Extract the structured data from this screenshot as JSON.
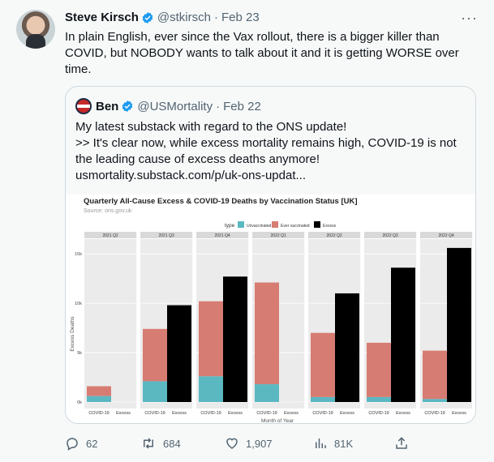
{
  "tweet": {
    "author_name": "Steve Kirsch",
    "handle": "@stkirsch",
    "separator": "·",
    "date": "Feb 23",
    "more": "···",
    "text": "In plain English, ever since the Vax rollout, there is a bigger killer than COVID, but NOBODY wants to talk about it and it is getting WORSE over time."
  },
  "quote": {
    "author_name": "Ben",
    "handle": "@USMortality",
    "separator": "·",
    "date": "Feb 22",
    "text_line1": "My latest substack with regard to the ONS update!",
    "text_line2": ">> It's clear now, while excess mortality remains high, COVID-19 is not the leading cause of excess deaths anymore!",
    "link": "usmortality.substack.com/p/uk-ons-updat..."
  },
  "actions": {
    "reply_count": "62",
    "retweet_count": "684",
    "like_count": "1,907",
    "views_count": "81K"
  },
  "colors": {
    "accent": "#1d9bf0",
    "unvaccinated": "#5bb8c1",
    "ever_vaccinated": "#d77c72",
    "excess": "#000000"
  },
  "chart_data": {
    "type": "bar",
    "title": "Quarterly All-Cause Excess & COVID-19 Deaths by Vaccination Status [UK]",
    "subtitle": "Source: ons.gov.uk",
    "legend_title": "type",
    "legend": [
      "Unvaccinated",
      "Ever vaccinated",
      "Excess"
    ],
    "legend_position": "top",
    "xlabel": "Month of Year",
    "ylabel": "Excess Deaths",
    "ylim": [
      0,
      16000
    ],
    "yticks": [
      "0k",
      "5k",
      "10k",
      "15k"
    ],
    "ytick_values": [
      0,
      5000,
      10000,
      15000
    ],
    "categories": [
      "COVID-19",
      "Excess"
    ],
    "panels": [
      {
        "label": "2021 Q2",
        "covid_unvaccinated": 600,
        "covid_ever_vaccinated": 1000,
        "excess": 0
      },
      {
        "label": "2021 Q3",
        "covid_unvaccinated": 2100,
        "covid_ever_vaccinated": 5300,
        "excess": 9800
      },
      {
        "label": "2021 Q4",
        "covid_unvaccinated": 2600,
        "covid_ever_vaccinated": 7600,
        "excess": 12700
      },
      {
        "label": "2022 Q1",
        "covid_unvaccinated": 1800,
        "covid_ever_vaccinated": 10300,
        "excess": 0
      },
      {
        "label": "2022 Q2",
        "covid_unvaccinated": 500,
        "covid_ever_vaccinated": 6500,
        "excess": 11000
      },
      {
        "label": "2022 Q3",
        "covid_unvaccinated": 500,
        "covid_ever_vaccinated": 5500,
        "excess": 13600
      },
      {
        "label": "2022 Q4",
        "covid_unvaccinated": 300,
        "covid_ever_vaccinated": 4900,
        "excess": 15600
      }
    ],
    "grid": true
  }
}
